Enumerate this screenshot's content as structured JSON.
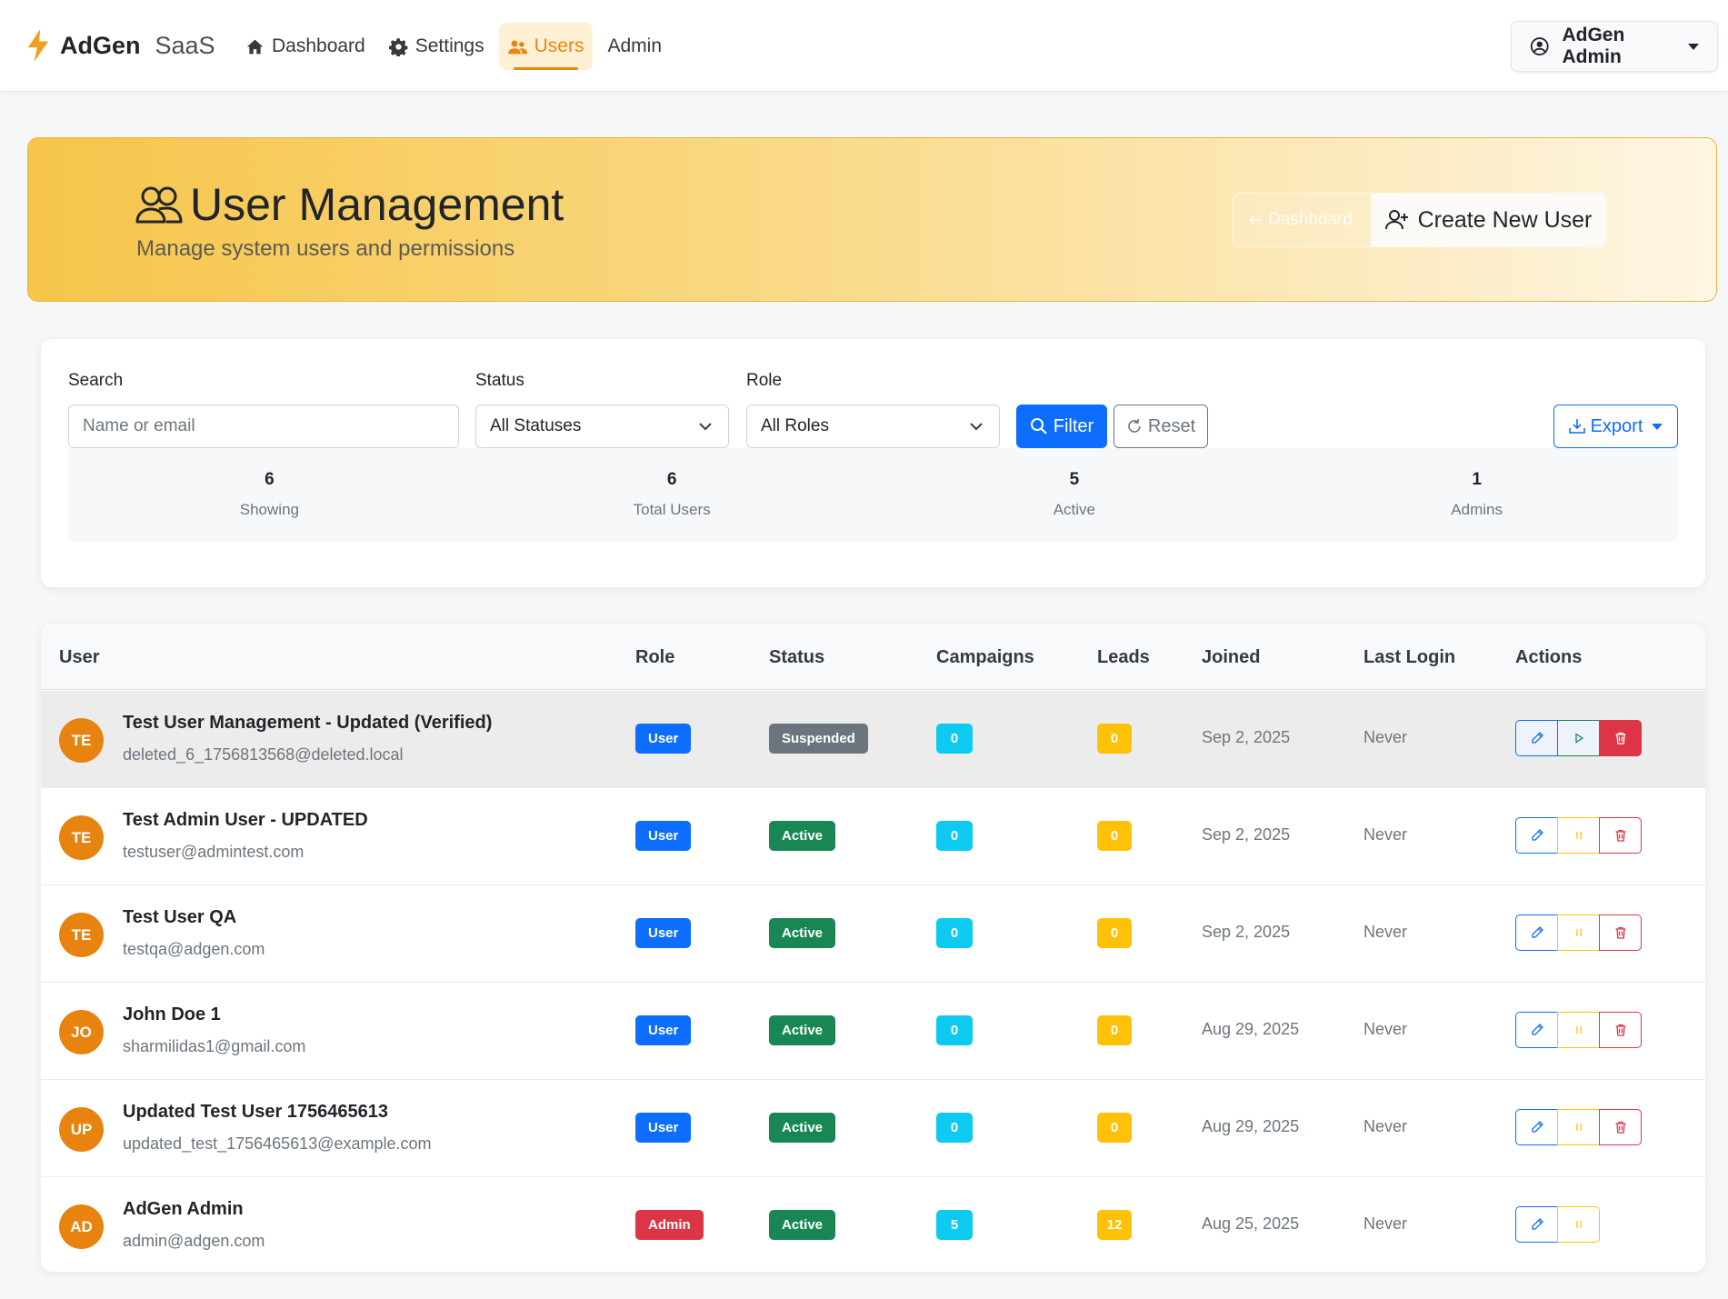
{
  "navbar": {
    "brand": "AdGen",
    "brand_suffix": "SaaS",
    "items": [
      {
        "label": "Dashboard",
        "icon": "home-icon"
      },
      {
        "label": "Settings",
        "icon": "gear-icon"
      },
      {
        "label": "Users",
        "icon": "users-icon",
        "active": true
      },
      {
        "label": "Admin"
      }
    ],
    "user_menu_label": "AdGen Admin"
  },
  "hero": {
    "title": "User Management",
    "subtitle": "Manage system users and permissions",
    "dashboard_label": "Dashboard",
    "create_label": "Create New User"
  },
  "filters": {
    "search_label": "Search",
    "search_placeholder": "Name or email",
    "status_label": "Status",
    "status_value": "All Statuses",
    "role_label": "Role",
    "role_value": "All Roles",
    "filter_label": "Filter",
    "reset_label": "Reset",
    "export_label": "Export"
  },
  "stats": [
    {
      "value": "6",
      "label": "Showing"
    },
    {
      "value": "6",
      "label": "Total Users"
    },
    {
      "value": "5",
      "label": "Active"
    },
    {
      "value": "1",
      "label": "Admins"
    }
  ],
  "table": {
    "headers": [
      "User",
      "Role",
      "Status",
      "Campaigns",
      "Leads",
      "Joined",
      "Last Login",
      "Actions"
    ],
    "rows": [
      {
        "initials": "TE",
        "name": "Test User Management - Updated (Verified)",
        "email": "deleted_6_1756813568@deleted.local",
        "role": "User",
        "status": "Suspended",
        "campaigns": "0",
        "leads": "0",
        "joined": "Sep 2, 2025",
        "last_login": "Never"
      },
      {
        "initials": "TE",
        "name": "Test Admin User - UPDATED",
        "email": "testuser@admintest.com",
        "role": "User",
        "status": "Active",
        "campaigns": "0",
        "leads": "0",
        "joined": "Sep 2, 2025",
        "last_login": "Never"
      },
      {
        "initials": "TE",
        "name": "Test User QA",
        "email": "testqa@adgen.com",
        "role": "User",
        "status": "Active",
        "campaigns": "0",
        "leads": "0",
        "joined": "Sep 2, 2025",
        "last_login": "Never"
      },
      {
        "initials": "JO",
        "name": "John Doe 1",
        "email": "sharmilidas1@gmail.com",
        "role": "User",
        "status": "Active",
        "campaigns": "0",
        "leads": "0",
        "joined": "Aug 29, 2025",
        "last_login": "Never"
      },
      {
        "initials": "UP",
        "name": "Updated Test User 1756465613",
        "email": "updated_test_1756465613@example.com",
        "role": "User",
        "status": "Active",
        "campaigns": "0",
        "leads": "0",
        "joined": "Aug 29, 2025",
        "last_login": "Never"
      },
      {
        "initials": "AD",
        "name": "AdGen Admin",
        "email": "admin@adgen.com",
        "role": "Admin",
        "status": "Active",
        "campaigns": "5",
        "leads": "12",
        "joined": "Aug 25, 2025",
        "last_login": "Never"
      }
    ]
  },
  "colors": {
    "accent": "#e8870c",
    "primary": "#0d6efd",
    "success": "#198754",
    "danger": "#dc3545",
    "warning": "#ffc107",
    "info": "#0dcaf0"
  }
}
